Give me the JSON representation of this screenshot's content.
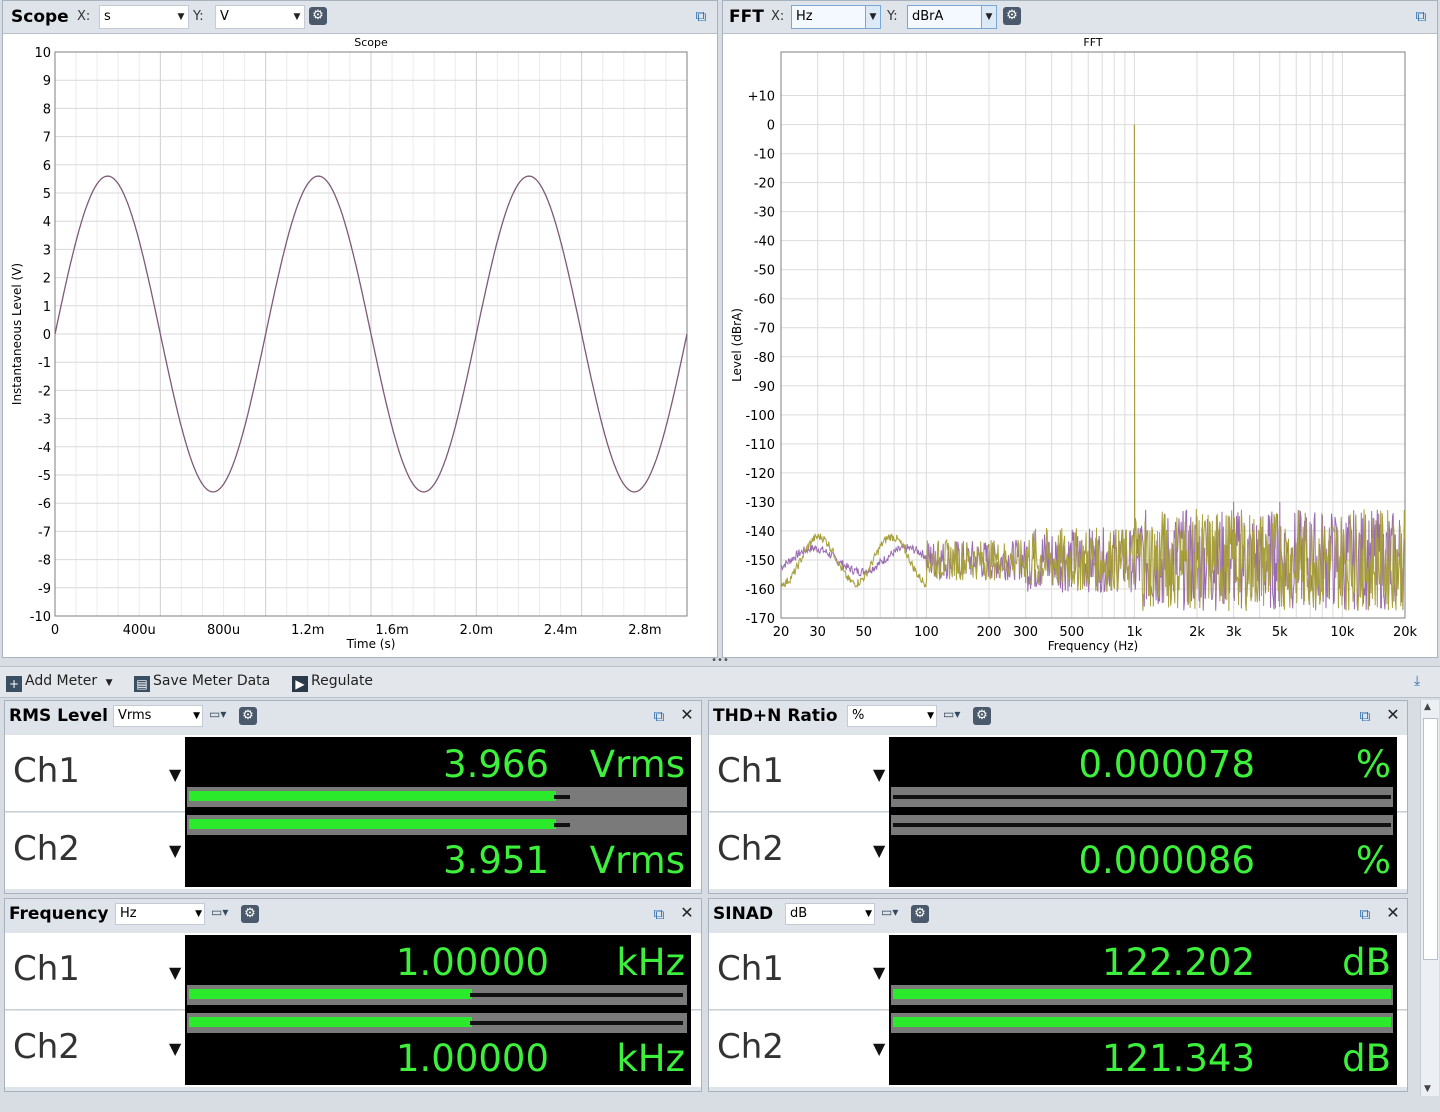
{
  "scope": {
    "title": "Scope",
    "x_label": "X:",
    "x_unit": "s",
    "y_label": "Y:",
    "y_unit": "V",
    "chart_data": {
      "type": "line",
      "title": "Scope",
      "xlabel": "Time (s)",
      "ylabel": "Instantaneous Level (V)",
      "xlim": [
        0,
        0.003
      ],
      "ylim": [
        -10,
        10
      ],
      "x_ticks": [
        "0",
        "400u",
        "800u",
        "1.2m",
        "1.6m",
        "2.0m",
        "2.4m",
        "2.8m"
      ],
      "y_ticks": [
        "10",
        "9",
        "8",
        "7",
        "6",
        "5",
        "4",
        "3",
        "2",
        "1",
        "0",
        "-1",
        "-2",
        "-3",
        "-4",
        "-5",
        "-6",
        "-7",
        "-8",
        "-9",
        "-10"
      ],
      "series": [
        {
          "amplitude": 5.6,
          "frequency": 1000,
          "color": "#7d5a78"
        }
      ],
      "grid": true
    }
  },
  "fft": {
    "title": "FFT",
    "x_label": "X:",
    "x_unit": "Hz",
    "y_label": "Y:",
    "y_unit": "dBrA",
    "chart_data": {
      "type": "line",
      "title": "FFT",
      "xlabel": "Frequency (Hz)",
      "ylabel": "Level (dBrA)",
      "xscale": "log",
      "xlim": [
        20,
        20000
      ],
      "ylim": [
        -170,
        10
      ],
      "x_ticks": [
        "20",
        "30",
        "50",
        "100",
        "200",
        "300",
        "500",
        "1k",
        "2k",
        "3k",
        "5k",
        "10k",
        "20k"
      ],
      "y_ticks": [
        "+10",
        "0",
        "-10",
        "-20",
        "-30",
        "-40",
        "-50",
        "-60",
        "-70",
        "-80",
        "-90",
        "-100",
        "-110",
        "-120",
        "-130",
        "-140",
        "-150",
        "-160",
        "-170"
      ],
      "series": [
        {
          "color": "#9a6bb0",
          "peaks": [
            [
              1000,
              0
            ],
            [
              2000,
              -135
            ],
            [
              3000,
              -130
            ],
            [
              5000,
              -130
            ]
          ]
        },
        {
          "color": "#a7a03c",
          "peaks": [
            [
              1000,
              0
            ]
          ]
        }
      ],
      "grid": true
    }
  },
  "toolbar": {
    "add_meter": "Add Meter",
    "save_meter_data": "Save Meter Data",
    "regulate": "Regulate"
  },
  "meters": [
    {
      "title": "RMS Level",
      "unit_select": "Vrms",
      "ch1": {
        "label": "Ch1",
        "value": "3.966",
        "unit": "Vrms",
        "bar_level": 0.74
      },
      "ch2": {
        "label": "Ch2",
        "value": "3.951",
        "unit": "Vrms",
        "bar_level": 0.74
      }
    },
    {
      "title": "THD+N Ratio",
      "unit_select": "%",
      "ch1": {
        "label": "Ch1",
        "value": "0.000078",
        "unit": "%",
        "bar_level": 0.0
      },
      "ch2": {
        "label": "Ch2",
        "value": "0.000086",
        "unit": "%",
        "bar_level": 0.0
      }
    },
    {
      "title": "Frequency",
      "unit_select": "Hz",
      "ch1": {
        "label": "Ch1",
        "value": "1.00000",
        "unit": "kHz",
        "bar_level": 0.57
      },
      "ch2": {
        "label": "Ch2",
        "value": "1.00000",
        "unit": "kHz",
        "bar_level": 0.57
      }
    },
    {
      "title": "SINAD",
      "unit_select": "dB",
      "ch1": {
        "label": "Ch1",
        "value": "122.202",
        "unit": "dB",
        "bar_level": 1.0
      },
      "ch2": {
        "label": "Ch2",
        "value": "121.343",
        "unit": "dB",
        "bar_level": 1.0
      }
    }
  ]
}
